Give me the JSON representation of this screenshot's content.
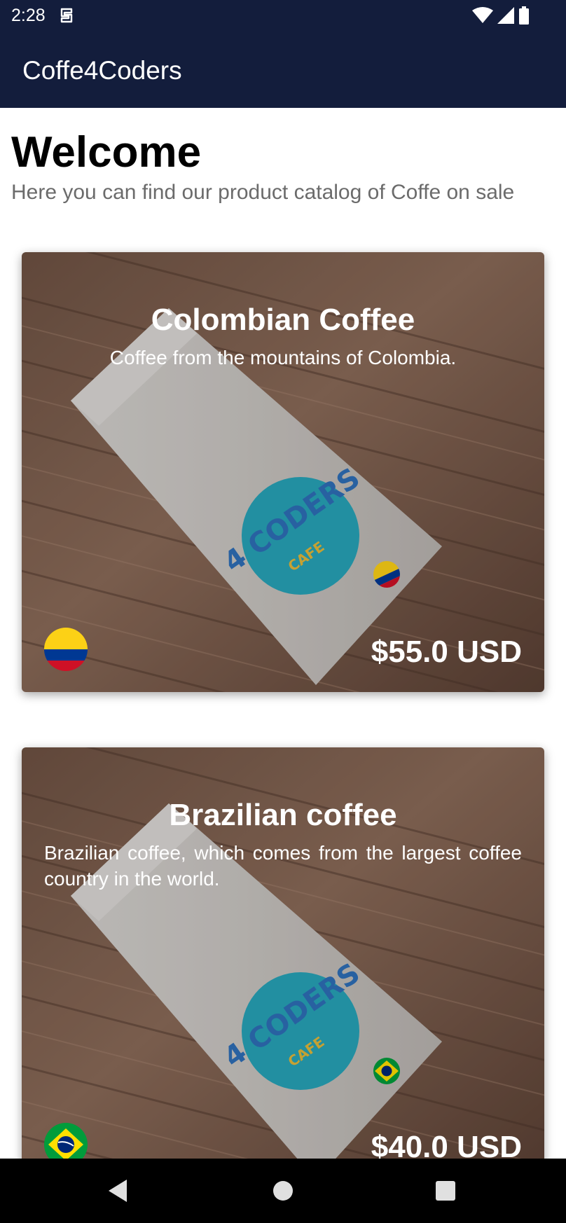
{
  "status_bar": {
    "time": "2:28",
    "icons": [
      "app-status-icon",
      "wifi-icon",
      "cell-signal-icon",
      "battery-icon"
    ]
  },
  "app_bar": {
    "title": "Coffe4Coders"
  },
  "header": {
    "welcome": "Welcome",
    "subtitle": "Here you can find our product catalog of Coffe on sale"
  },
  "products": [
    {
      "name": "Colombian Coffee",
      "description": "Coffee from the mountains of Colombia.",
      "price": "$55.0 USD",
      "flag": "colombia-flag-icon",
      "package_logo": "4 CODERS CAFE"
    },
    {
      "name": "Brazilian coffee",
      "description": "Brazilian coffee, which comes from the largest coffee country in the world.",
      "price": "$40.0 USD",
      "flag": "brazil-flag-icon",
      "package_logo": "4 CODERS CAFE"
    }
  ],
  "nav_bar": {
    "buttons": [
      "back-icon",
      "home-icon",
      "recents-icon"
    ]
  },
  "colors": {
    "app_bar": "#131d3c",
    "card_text": "#ffffff",
    "subtitle_text": "#6b6b6b",
    "logo_circle": "#27a3b8"
  }
}
